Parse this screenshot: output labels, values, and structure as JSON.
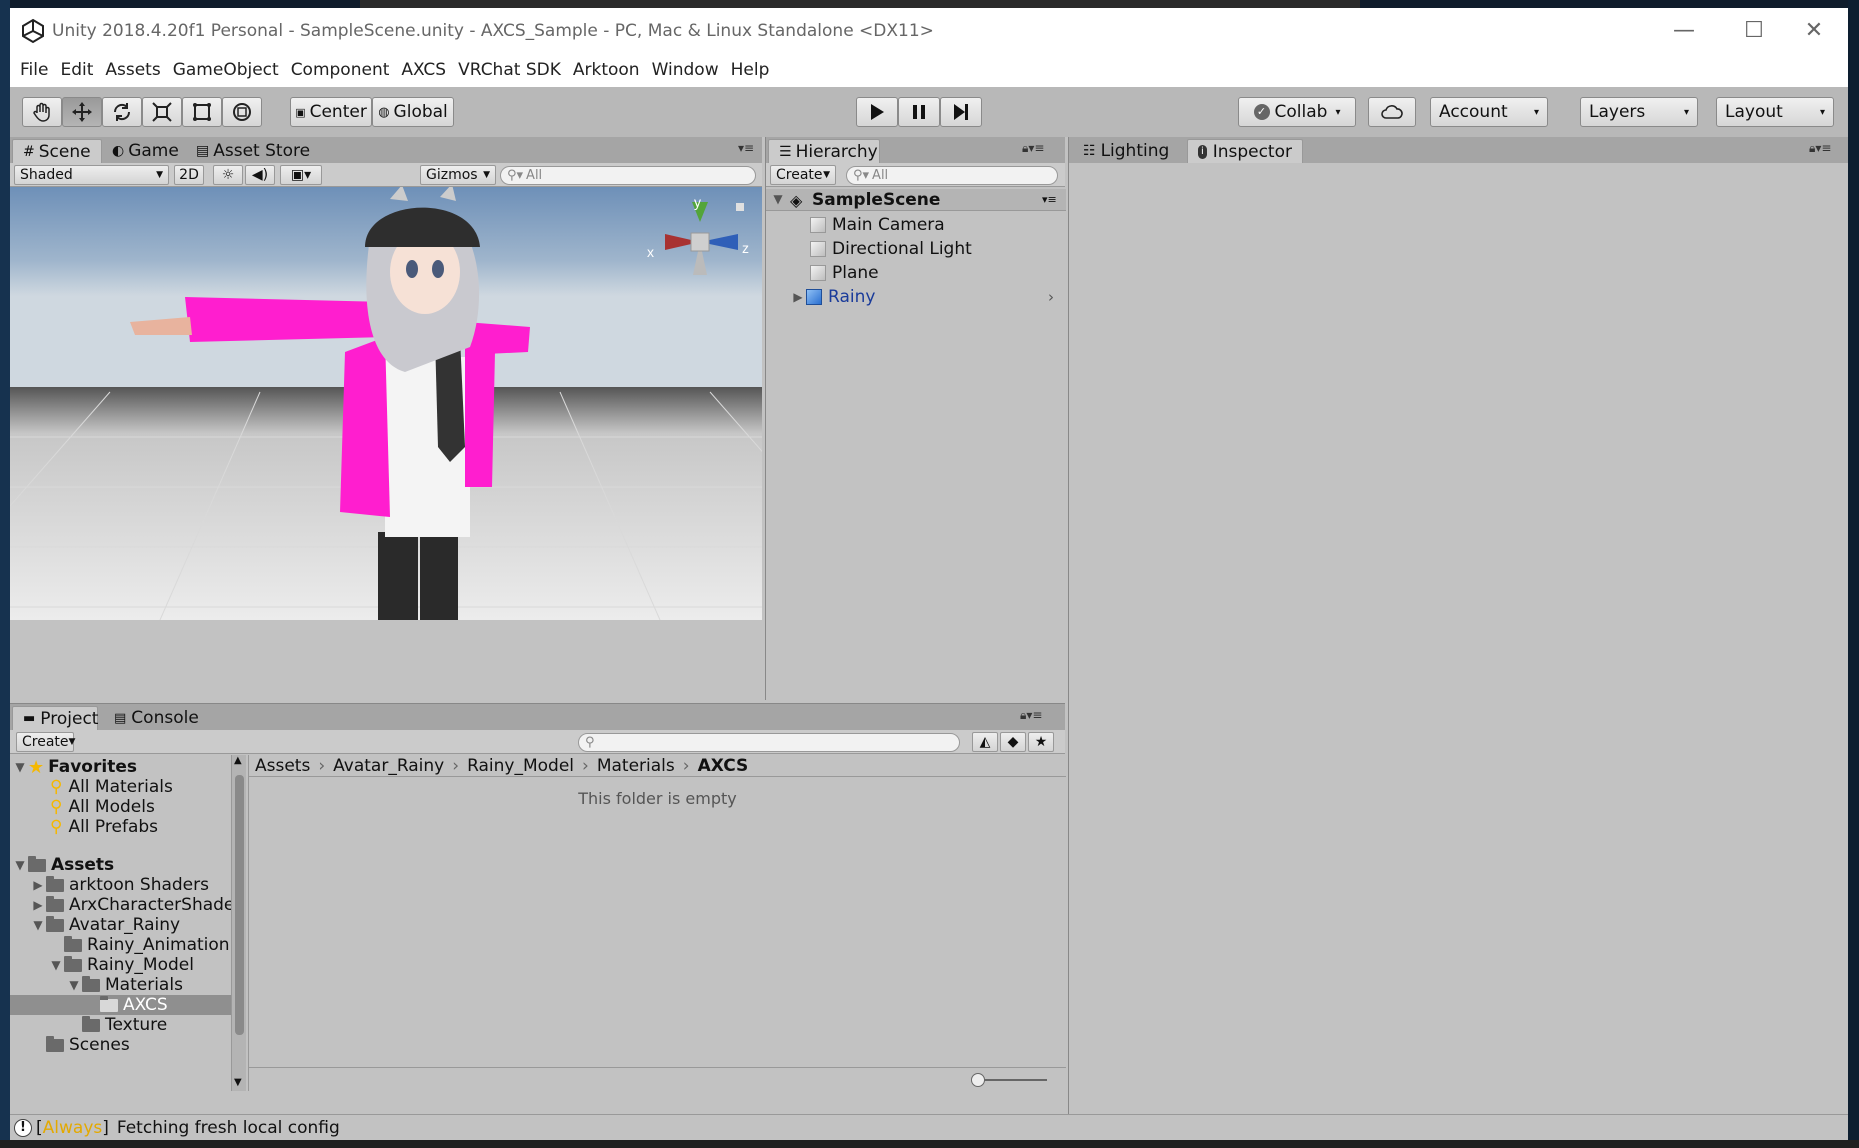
{
  "window": {
    "title": "Unity 2018.4.20f1 Personal - SampleScene.unity - AXCS_Sample - PC, Mac & Linux Standalone <DX11>",
    "controls": {
      "minimize": "—",
      "maximize": "☐",
      "close": "✕"
    }
  },
  "menu": [
    "File",
    "Edit",
    "Assets",
    "GameObject",
    "Component",
    "AXCS",
    "VRChat SDK",
    "Arktoon",
    "Window",
    "Help"
  ],
  "toolbar": {
    "pivot": "Center",
    "space": "Global",
    "collab": "Collab",
    "account": "Account",
    "layers": "Layers",
    "layout": "Layout",
    "dropdown_glyph": "▾"
  },
  "scene": {
    "tabs": [
      "Scene",
      "Game",
      "Asset Store"
    ],
    "shading": "Shaded",
    "mode_2d": "2D",
    "gizmos": "Gizmos",
    "search_placeholder": "All",
    "gizmo_axes": {
      "x": "x",
      "y": "y",
      "z": "z"
    },
    "skybox_top": "#6e90b8",
    "horizon_color": "#cfd8e0",
    "ground_color": "#e8e8e8",
    "hoodie_color": "#ff1ecf"
  },
  "hierarchy": {
    "tab": "Hierarchy",
    "create": "Create",
    "search_placeholder": "All",
    "scene_name": "SampleScene",
    "items": [
      {
        "label": "Main Camera",
        "selected": false
      },
      {
        "label": "Directional Light",
        "selected": false
      },
      {
        "label": "Plane",
        "selected": false
      },
      {
        "label": "Rainy",
        "selected": false,
        "prefab": true
      }
    ]
  },
  "inspector": {
    "tabs": [
      "Lighting",
      "Inspector"
    ]
  },
  "project": {
    "tabs": [
      "Project",
      "Console"
    ],
    "create": "Create",
    "favorites": {
      "label": "Favorites",
      "items": [
        "All Materials",
        "All Models",
        "All Prefabs"
      ]
    },
    "assets": {
      "label": "Assets",
      "tree": [
        {
          "label": "arktoon Shaders",
          "depth": 1,
          "arrow": "▶"
        },
        {
          "label": "ArxCharacterShaders",
          "depth": 1,
          "arrow": "▶"
        },
        {
          "label": "Avatar_Rainy",
          "depth": 1,
          "arrow": "▼"
        },
        {
          "label": "Rainy_Animation",
          "depth": 2,
          "arrow": ""
        },
        {
          "label": "Rainy_Model",
          "depth": 2,
          "arrow": "▼"
        },
        {
          "label": "Materials",
          "depth": 3,
          "arrow": "▼"
        },
        {
          "label": "AXCS",
          "depth": 4,
          "arrow": "",
          "selected": true
        },
        {
          "label": "Texture",
          "depth": 3,
          "arrow": ""
        },
        {
          "label": "Scenes",
          "depth": 1,
          "arrow": ""
        }
      ]
    },
    "breadcrumb": [
      "Assets",
      "Avatar_Rainy",
      "Rainy_Model",
      "Materials",
      "AXCS"
    ],
    "empty_message": "This folder is empty"
  },
  "status": {
    "prefix": "[",
    "tag": "Always",
    "suffix": "]",
    "message": "Fetching fresh local config"
  }
}
